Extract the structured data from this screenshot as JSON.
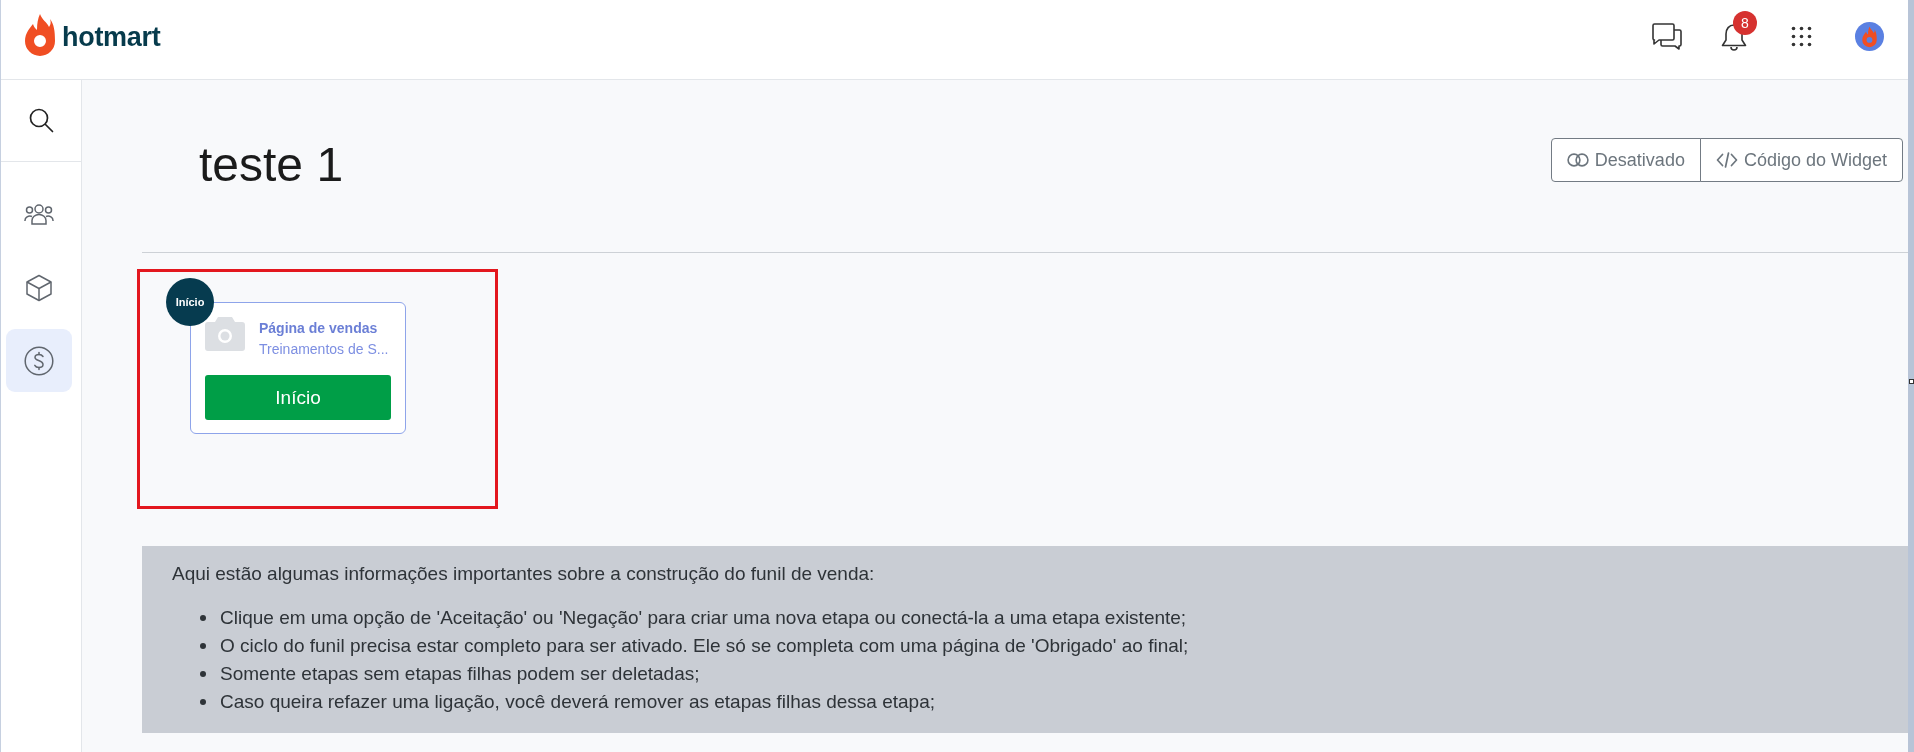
{
  "header": {
    "logo": "hotmart",
    "notification_count": "8"
  },
  "sidebar": {
    "items": [
      {
        "kind": "people",
        "selected": false
      },
      {
        "kind": "box",
        "selected": false
      },
      {
        "kind": "money",
        "selected": true
      }
    ]
  },
  "page": {
    "title": "teste 1",
    "actions": [
      {
        "kind": "toggle",
        "label": "Desativado"
      },
      {
        "kind": "code",
        "label": "Código do Widget"
      }
    ]
  },
  "funnel": {
    "steps": [
      {
        "badge": "Início",
        "title": "Página de vendas",
        "subtitle": "Treinamentos de S...",
        "button": "Início"
      }
    ]
  },
  "info": {
    "intro": "Aqui estão algumas informações importantes sobre a construção do funil de venda:",
    "bullets": [
      "Clique em uma opção de 'Aceitação' ou 'Negação' para criar uma nova etapa ou conectá-la a uma etapa existente;",
      "O ciclo do funil precisa estar completo para ser ativado. Ele só se completa com uma página de 'Obrigado' ao final;",
      "Somente etapas sem etapas filhas podem ser deletadas;",
      "Caso queira refazer uma ligação, você deverá remover as etapas filhas dessa etapa;"
    ]
  }
}
